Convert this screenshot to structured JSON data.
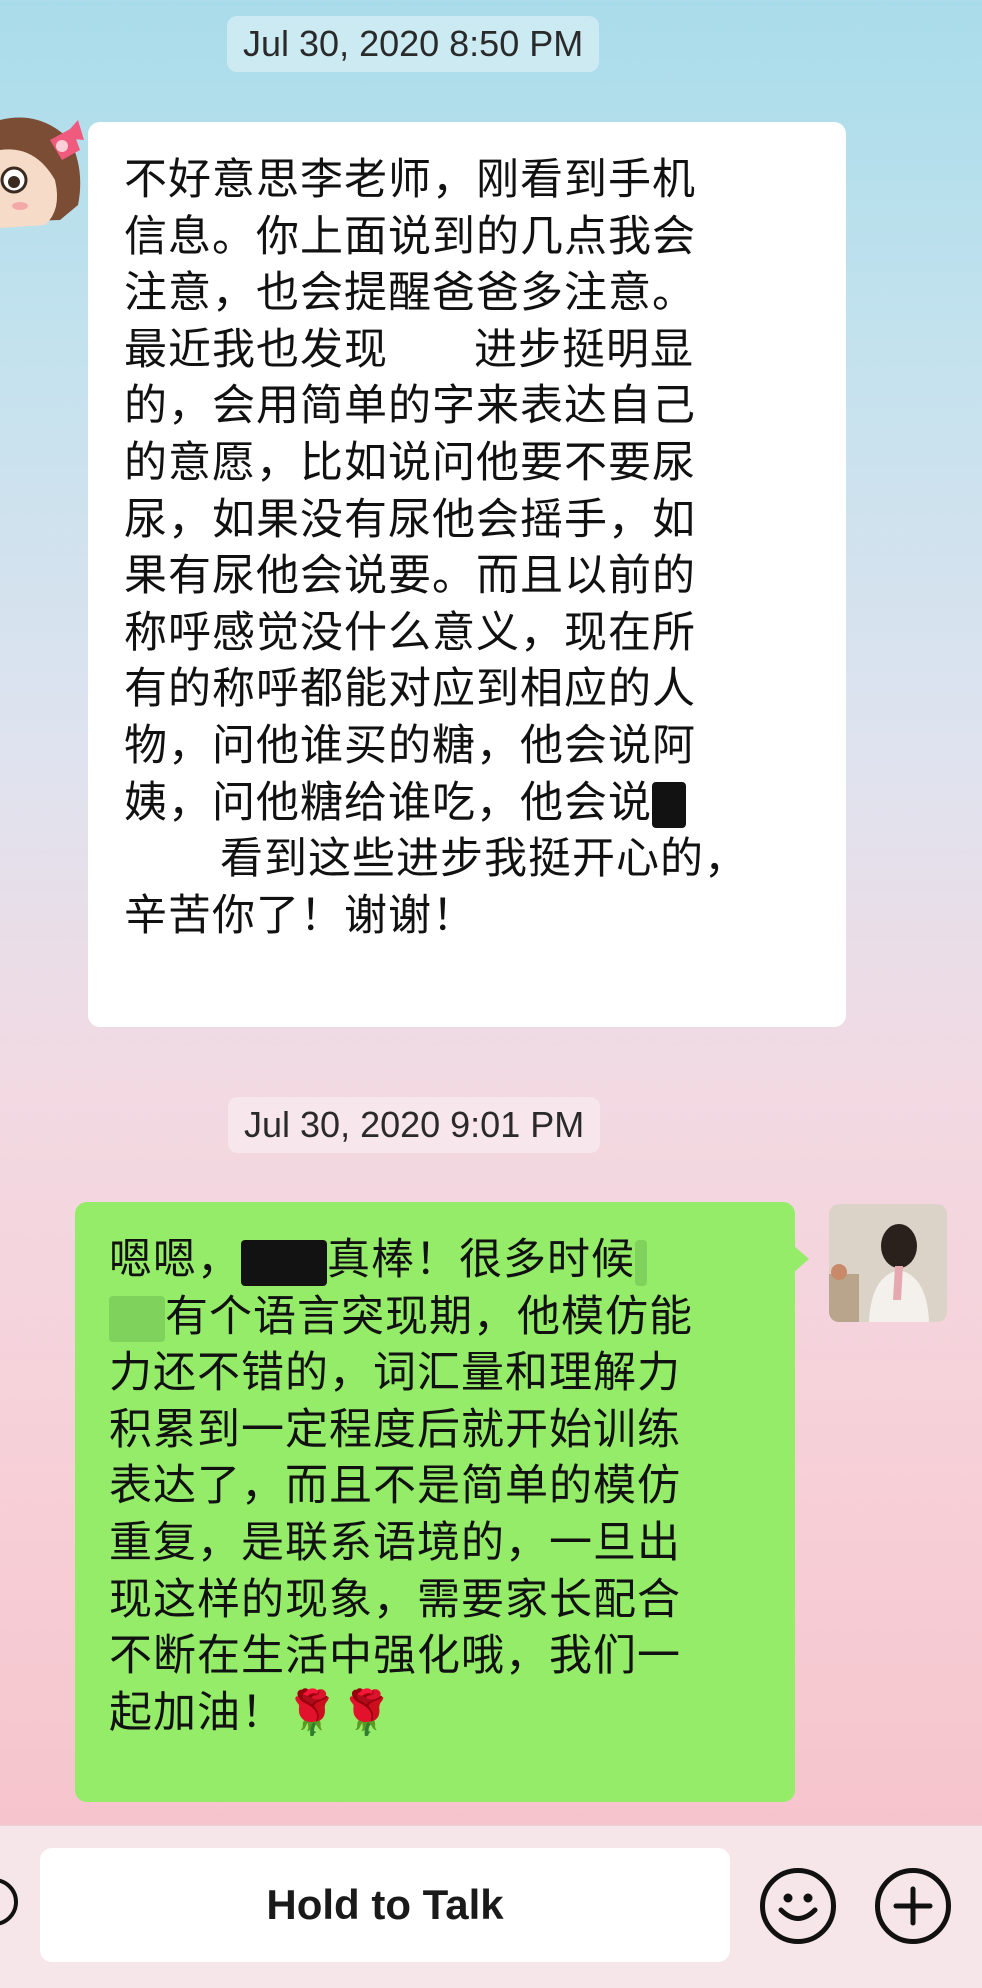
{
  "chat": {
    "timestamps": [
      "Jul 30, 2020 8:50 PM",
      "Jul 30, 2020 9:01 PM"
    ],
    "incoming_message": {
      "lines": [
        "不好意思李老师，刚看到手机",
        "信息。你上面说到的几点我会",
        "注意，也会提醒爸爸多注意。",
        "最近我也发现",
        "进步挺明显",
        "的，会用简单的字来表达自己",
        "的意愿，比如说问他要不要尿",
        "尿，如果没有尿他会摇手，如",
        "果有尿他会说要。而且以前的",
        "称呼感觉没什么意义，现在所",
        "有的称呼都能对应到相应的人",
        "物，问他谁买的糖，他会说阿",
        "姨，问他糖给谁吃，他会说",
        "看到这些进步我挺开心的，",
        "辛苦你了！谢谢！"
      ]
    },
    "outgoing_message": {
      "lines": [
        "嗯嗯，",
        "真棒！很多时候",
        "有个语言突现期，他模仿能",
        "力还不错的，词汇量和理解力",
        "积累到一定程度后就开始训练",
        "表达了，而且不是简单的模仿",
        "重复，是联系语境的，一旦出",
        "现这样的现象，需要家长配合",
        "不断在生活中强化哦，我们一",
        "起加油！",
        "🌹🌹"
      ]
    }
  },
  "input_bar": {
    "hold_to_talk_label": "Hold to Talk",
    "icons": [
      "voice-icon",
      "emoji-icon",
      "plus-icon"
    ]
  },
  "colors": {
    "outgoing_bubble": "#95ec69",
    "incoming_bubble": "#ffffff",
    "input_bar_bg": "#f6e6e9"
  }
}
